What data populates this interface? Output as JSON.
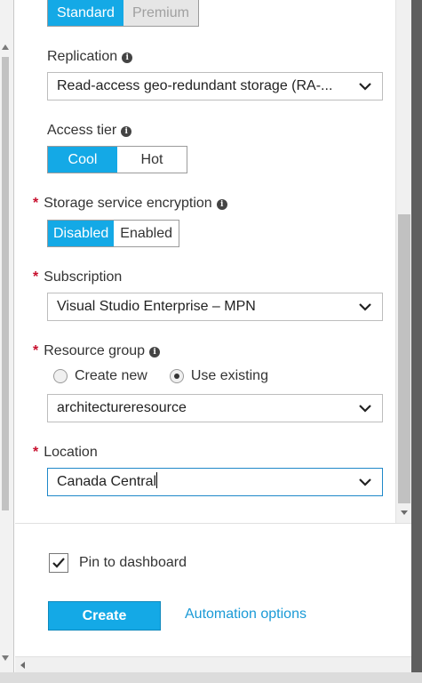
{
  "performance": {
    "options": [
      "Standard",
      "Premium"
    ],
    "selected": "Standard"
  },
  "replication": {
    "label": "Replication",
    "value": "Read-access geo-redundant storage (RA-..."
  },
  "access_tier": {
    "label": "Access tier",
    "options": [
      "Cool",
      "Hot"
    ],
    "selected": "Cool"
  },
  "encryption": {
    "label": "Storage service encryption",
    "options": [
      "Disabled",
      "Enabled"
    ],
    "selected": "Disabled"
  },
  "subscription": {
    "label": "Subscription",
    "value": "Visual Studio Enterprise – MPN"
  },
  "resource_group": {
    "label": "Resource group",
    "radio_options": [
      "Create new",
      "Use existing"
    ],
    "radio_selected": "Use existing",
    "value": "architectureresource"
  },
  "location": {
    "label": "Location",
    "value": "Canada Central"
  },
  "footer": {
    "pin_label": "Pin to dashboard",
    "pin_checked": true,
    "create_label": "Create",
    "automation_label": "Automation options"
  },
  "colors": {
    "accent": "#14a9e6",
    "required": "#c8102e",
    "link": "#1a9ad6"
  }
}
